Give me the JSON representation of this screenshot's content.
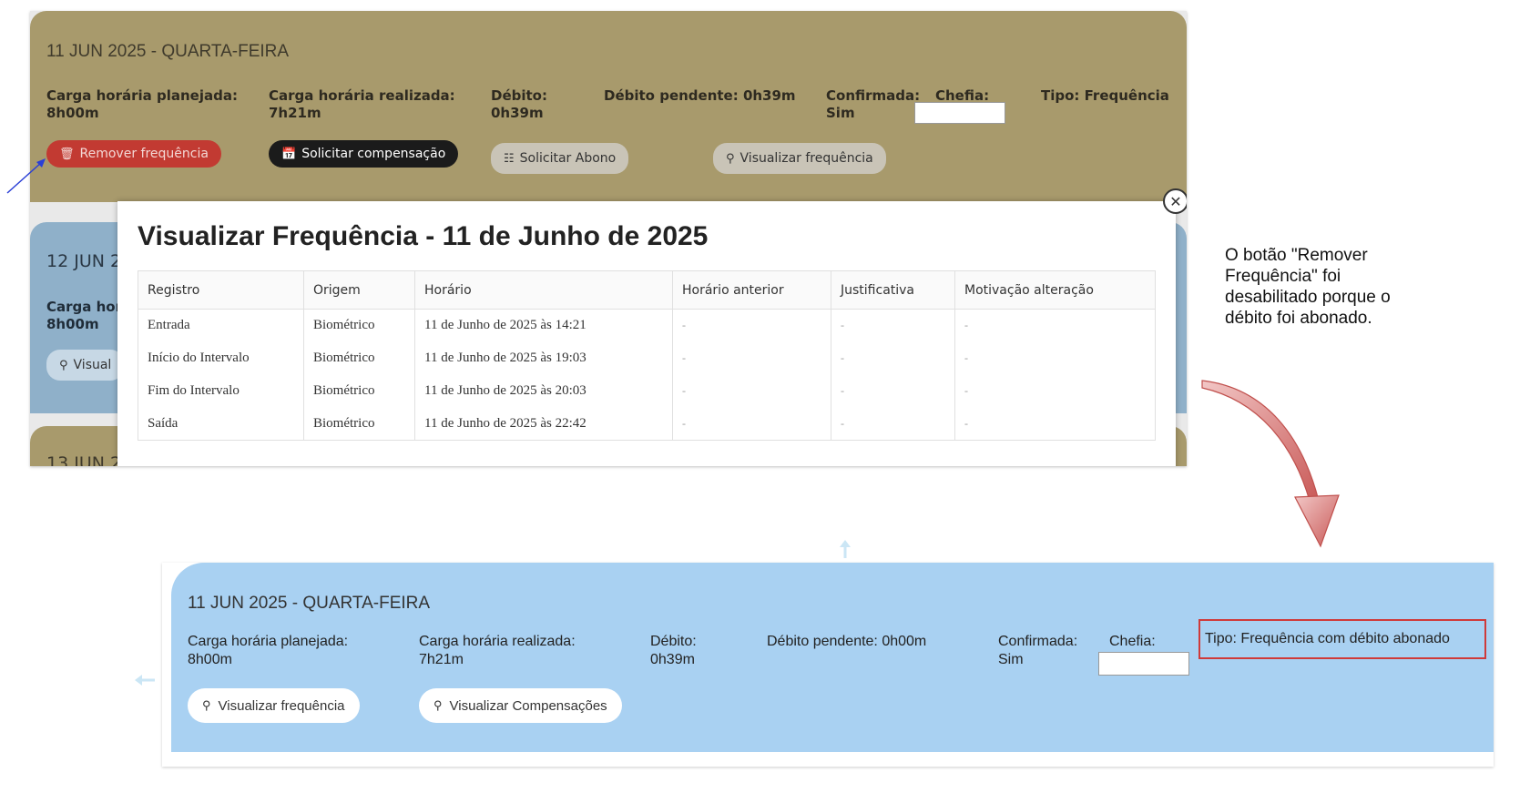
{
  "top": {
    "card1": {
      "date": "11 JUN 2025 - QUARTA-FEIRA",
      "planned_label": "Carga horária planejada:",
      "planned_value": "8h00m",
      "done_label": "Carga horária realizada:",
      "done_value": "7h21m",
      "debit_label": "Débito:",
      "debit_value": "0h39m",
      "pending": "Débito pendente: 0h39m",
      "confirmed_label": "Confirmada:",
      "confirmed_value": "Sim",
      "chefia_label": "Chefia:",
      "tipo": "Tipo: Frequência",
      "btn_remove": "Remover frequência",
      "btn_compensacao": "Solicitar compensação",
      "btn_abono": "Solicitar Abono",
      "btn_visualizar": "Visualizar frequência"
    },
    "card2": {
      "date": "12 JUN 2",
      "planned_label": "Carga hora",
      "planned_value": "8h00m",
      "btn_visualizar": "Visual"
    },
    "card3": {
      "date": "13 JUN 2"
    },
    "modal": {
      "title": "Visualizar Frequência - 11 de Junho de 2025",
      "columns": [
        "Registro",
        "Origem",
        "Horário",
        "Horário anterior",
        "Justificativa",
        "Motivação alteração"
      ],
      "rows": [
        [
          "Entrada",
          "Biométrico",
          "11 de Junho de 2025 às 14:21",
          "-",
          "-",
          "-"
        ],
        [
          "Início do Intervalo",
          "Biométrico",
          "11 de Junho de 2025 às 19:03",
          "-",
          "-",
          "-"
        ],
        [
          "Fim do Intervalo",
          "Biométrico",
          "11 de Junho de 2025 às 20:03",
          "-",
          "-",
          "-"
        ],
        [
          "Saída",
          "Biométrico",
          "11 de Junho de 2025 às 22:42",
          "-",
          "-",
          "-"
        ]
      ]
    }
  },
  "annotation": {
    "text": "O botão \"Remover Frequência\" foi desabilitado porque o débito foi abonado."
  },
  "bottom": {
    "date": "11 JUN 2025 - QUARTA-FEIRA",
    "planned_label": "Carga horária planejada:",
    "planned_value": "8h00m",
    "done_label": "Carga horária realizada:",
    "done_value": "7h21m",
    "debit_label": "Débito:",
    "debit_value": "0h39m",
    "pending": "Débito pendente: 0h00m",
    "confirmed_label": "Confirmada:",
    "confirmed_value": "Sim",
    "chefia_label": "Chefia:",
    "tipo": "Tipo: Frequência com débito abonado",
    "btn_visualizar": "Visualizar frequência",
    "btn_compensacoes": "Visualizar Compensações"
  },
  "colors": {
    "olive_card": "#a89a6c",
    "blue_card": "#a9d1f2",
    "remove_button": "#c23a32",
    "highlight_border": "#cf3a3a",
    "annotation_arrow": "#c0504d"
  }
}
